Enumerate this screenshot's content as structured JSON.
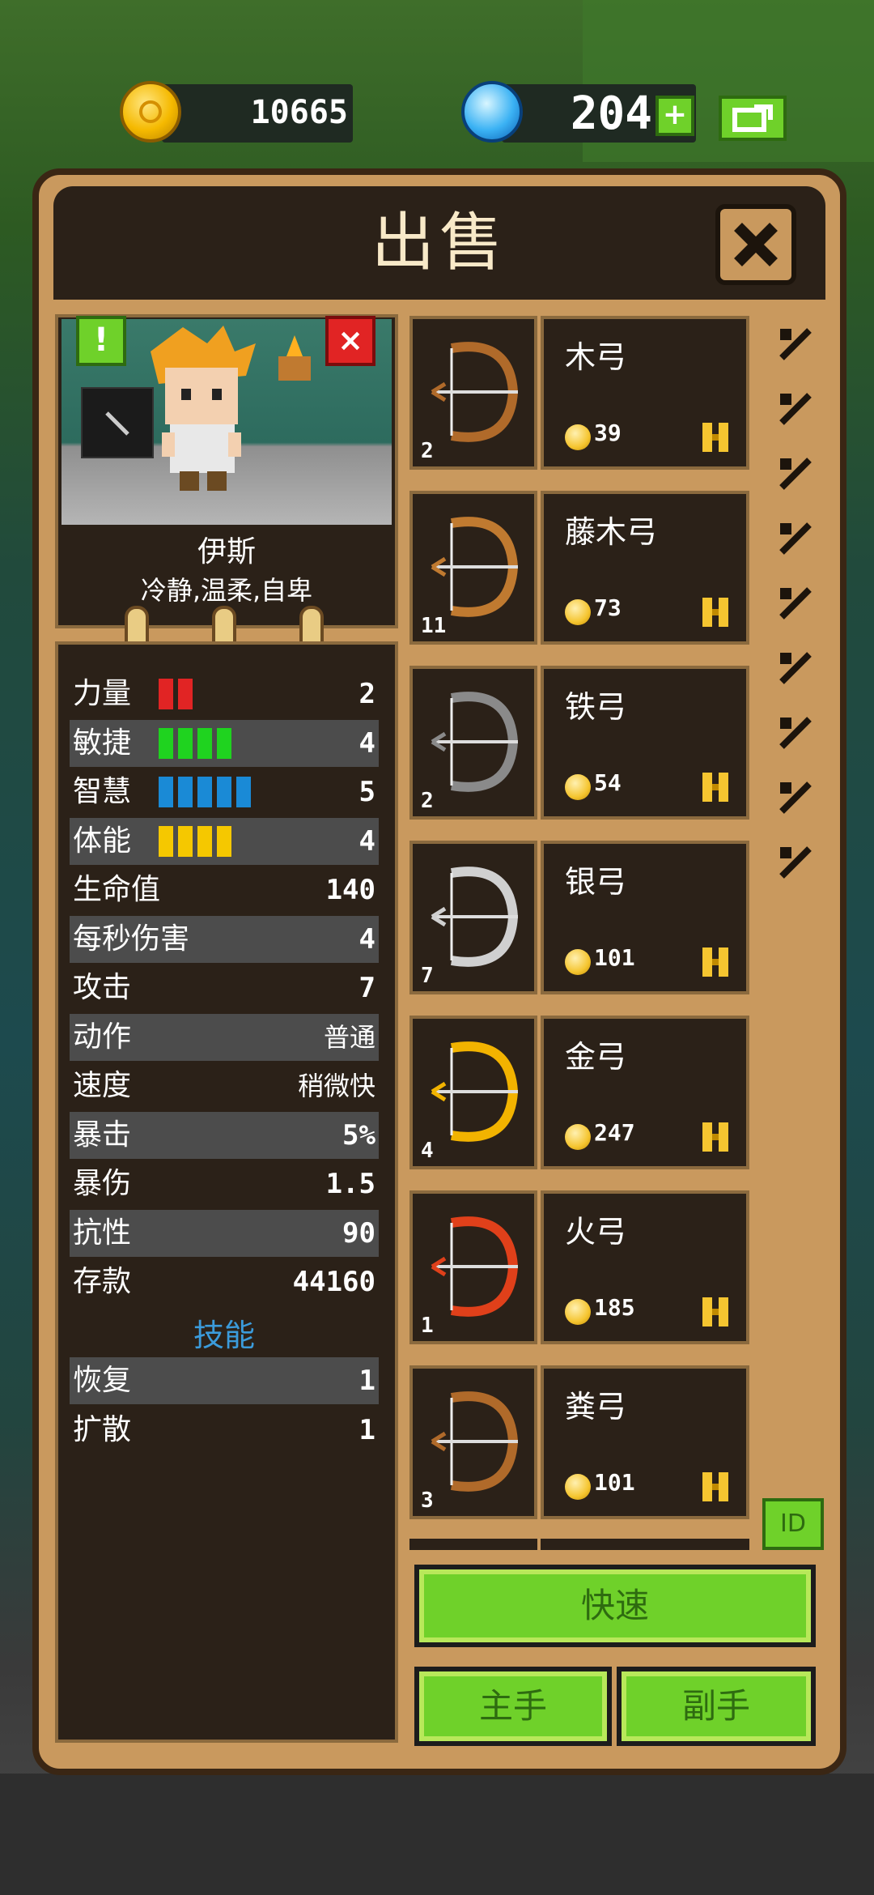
{
  "currency": {
    "gold": "10665",
    "gems": "204",
    "add_label": "+"
  },
  "dialog": {
    "title": "出售"
  },
  "hero": {
    "name": "伊斯",
    "traits": "冷静,温柔,自卑",
    "badge_alert": "!",
    "badge_close": "×"
  },
  "stats": [
    {
      "label": "力量",
      "value": "2",
      "bars": 2,
      "bar_color": "#e12424"
    },
    {
      "label": "敏捷",
      "value": "4",
      "bars": 4,
      "bar_color": "#1fd31f"
    },
    {
      "label": "智慧",
      "value": "5",
      "bars": 5,
      "bar_color": "#1a8ad6"
    },
    {
      "label": "体能",
      "value": "4",
      "bars": 4,
      "bar_color": "#f5c800"
    },
    {
      "label": "生命值",
      "value": "140"
    },
    {
      "label": "每秒伤害",
      "value": "4"
    },
    {
      "label": "攻击",
      "value": "7"
    },
    {
      "label": "动作",
      "value": "普通"
    },
    {
      "label": "速度",
      "value": "稍微快"
    },
    {
      "label": "暴击",
      "value": "5%"
    },
    {
      "label": "暴伤",
      "value": "1.5"
    },
    {
      "label": "抗性",
      "value": "90"
    },
    {
      "label": "存款",
      "value": "44160"
    }
  ],
  "skills_title": "技能",
  "skills": [
    {
      "label": "恢复",
      "value": "1"
    },
    {
      "label": "扩散",
      "value": "1"
    }
  ],
  "items": [
    {
      "name": "木弓",
      "count": "2",
      "price": "39",
      "color": "#b06a2a"
    },
    {
      "name": "藤木弓",
      "count": "11",
      "price": "73",
      "color": "#c07a30"
    },
    {
      "name": "铁弓",
      "count": "2",
      "price": "54",
      "color": "#8a8a8a"
    },
    {
      "name": "银弓",
      "count": "7",
      "price": "101",
      "color": "#d0d0d0"
    },
    {
      "name": "金弓",
      "count": "4",
      "price": "247",
      "color": "#f2b300"
    },
    {
      "name": "火弓",
      "count": "1",
      "price": "185",
      "color": "#e0401a"
    },
    {
      "name": "粪弓",
      "count": "3",
      "price": "101",
      "color": "#b06a2a"
    }
  ],
  "filters": [
    "all-items-icon",
    "dagger-icon",
    "sword-icon",
    "axe-icon",
    "hammer-icon",
    "spear-icon",
    "shield-icon",
    "bow-icon",
    "armor-icon"
  ],
  "buttons": {
    "id": "ID",
    "quick": "快速",
    "main_hand": "主手",
    "off_hand": "副手"
  }
}
